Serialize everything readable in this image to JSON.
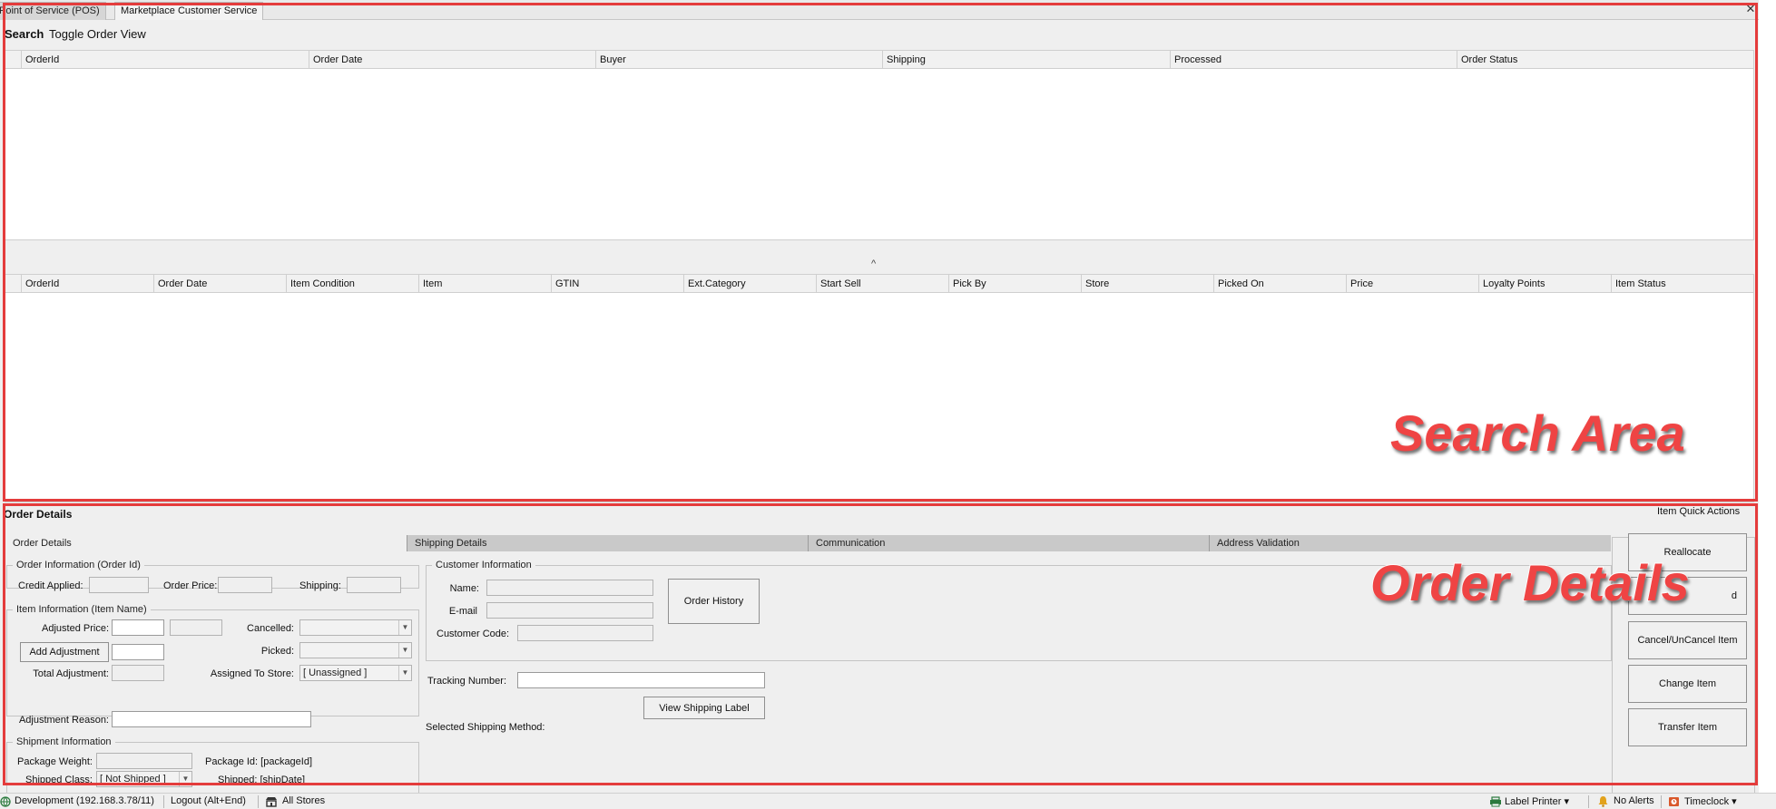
{
  "tabs": [
    {
      "label": "Point of Service (POS)",
      "active": false
    },
    {
      "label": "Marketplace Customer Service",
      "active": true
    }
  ],
  "close_glyph": "✕",
  "menu": {
    "search": "Search",
    "toggle_order_view": "Toggle Order View"
  },
  "orders_grid": {
    "columns": [
      "OrderId",
      "Order Date",
      "Buyer",
      "Shipping",
      "Processed",
      "Order Status"
    ]
  },
  "splitter_glyph": "^",
  "items_grid": {
    "columns": [
      "OrderId",
      "Order Date",
      "Item Condition",
      "Item",
      "GTIN",
      "Ext.Category",
      "Start Sell",
      "Pick By",
      "Store",
      "Picked On",
      "Price",
      "Loyalty Points",
      "Item Status"
    ]
  },
  "annotations": {
    "search_area": "Search Area",
    "order_details": "Order Details",
    "box_color": "#e43c3c"
  },
  "order_details": {
    "title": "Order Details",
    "subtabs": [
      "Order Details",
      "Shipping Details",
      "Communication",
      "Address Validation"
    ],
    "order_info": {
      "legend": "Order Information (Order Id)",
      "credit_applied": "Credit Applied:",
      "order_price": "Order Price:",
      "shipping": "Shipping:"
    },
    "item_info": {
      "legend": "Item Information (Item Name)",
      "adjusted_price": "Adjusted Price:",
      "cancelled": "Cancelled:",
      "add_adjustment": "Add Adjustment",
      "picked": "Picked:",
      "total_adjustment": "Total Adjustment:",
      "assigned_to_store": "Assigned To Store:",
      "assigned_value": "[ Unassigned ]",
      "adjustment_reason": "Adjustment Reason:"
    },
    "shipment_info": {
      "legend": "Shipment Information",
      "package_weight": "Package Weight:",
      "package_id": "Package Id: [packageId]",
      "shipped_class": "Shipped Class:",
      "shipped_class_value": "[ Not Shipped ]",
      "shipped": "Shipped: [shipDate]"
    },
    "customer_info": {
      "legend": "Customer Information",
      "name": "Name:",
      "email": "E-mail",
      "customer_code": "Customer Code:",
      "order_history": "Order History"
    },
    "tracking_number": "Tracking Number:",
    "view_shipping_label": "View Shipping Label",
    "selected_shipping_method": "Selected Shipping Method:",
    "quick_actions": {
      "title": "Item Quick Actions",
      "buttons": [
        "Reallocate",
        "d",
        "Cancel/UnCancel Item",
        "Change Item",
        "Transfer Item"
      ]
    }
  },
  "statusbar": {
    "env": "Development (192.168.3.78/11)",
    "logout": "Logout (Alt+End)",
    "stores": "All Stores",
    "label_printer": "Label Printer",
    "alerts": "No Alerts",
    "timeclock": "Timeclock",
    "caret": "▾"
  },
  "icons": {
    "env": "globe-icon",
    "stores": "store-icon",
    "printer": "printer-icon",
    "alerts": "bell-icon",
    "timeclock": "timeclock-icon"
  }
}
